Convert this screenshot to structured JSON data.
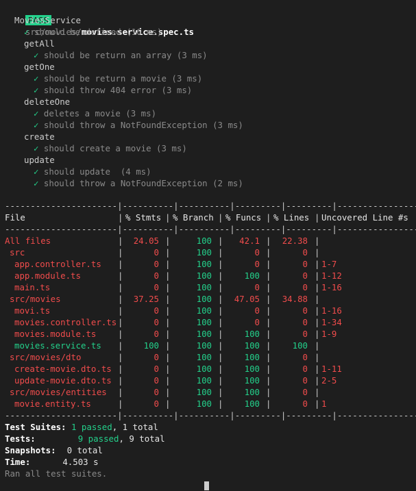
{
  "header": {
    "badge": "PASS",
    "path_dir": "src/movies/",
    "path_file": "movies.service.spec.ts"
  },
  "suite": {
    "name": "MoviesService",
    "groups": [
      {
        "name": "",
        "tests": [
          "should be defined (16 ms)"
        ]
      },
      {
        "name": "getAll",
        "tests": [
          "should be return an array (3 ms)"
        ]
      },
      {
        "name": "getOne",
        "tests": [
          "should be return a movie (3 ms)",
          "should throw 404 error (3 ms)"
        ]
      },
      {
        "name": "deleteOne",
        "tests": [
          "deletes a movie (3 ms)",
          "should throw a NotFoundException (3 ms)"
        ]
      },
      {
        "name": "create",
        "tests": [
          "should create a movie (3 ms)"
        ]
      },
      {
        "name": "update",
        "tests": [
          "should update  (4 ms)",
          "should throw a NotFoundException (2 ms)"
        ]
      }
    ],
    "check_glyph": "✓"
  },
  "coverage": {
    "divider": "----------------------|----------|----------|---------|---------|-------------------",
    "headers": [
      "File",
      "% Stmts",
      "% Branch",
      "% Funcs",
      "% Lines",
      "Uncovered Line #s"
    ],
    "rows": [
      {
        "file": "All files",
        "indent": 0,
        "stmts": "24.05",
        "branch": "100",
        "funcs": "42.1",
        "lines": "22.38",
        "uncovered": "",
        "file_color": "red",
        "colors": [
          "red",
          "green",
          "red",
          "red"
        ]
      },
      {
        "file": "src",
        "indent": 1,
        "stmts": "0",
        "branch": "100",
        "funcs": "0",
        "lines": "0",
        "uncovered": "",
        "file_color": "red",
        "colors": [
          "red",
          "green",
          "red",
          "red"
        ]
      },
      {
        "file": "app.controller.ts",
        "indent": 2,
        "stmts": "0",
        "branch": "100",
        "funcs": "0",
        "lines": "0",
        "uncovered": "1-7",
        "file_color": "red",
        "colors": [
          "red",
          "green",
          "red",
          "red"
        ]
      },
      {
        "file": "app.module.ts",
        "indent": 2,
        "stmts": "0",
        "branch": "100",
        "funcs": "100",
        "lines": "0",
        "uncovered": "1-12",
        "file_color": "red",
        "colors": [
          "red",
          "green",
          "green",
          "red"
        ]
      },
      {
        "file": "main.ts",
        "indent": 2,
        "stmts": "0",
        "branch": "100",
        "funcs": "0",
        "lines": "0",
        "uncovered": "1-16",
        "file_color": "red",
        "colors": [
          "red",
          "green",
          "red",
          "red"
        ]
      },
      {
        "file": "src/movies",
        "indent": 1,
        "stmts": "37.25",
        "branch": "100",
        "funcs": "47.05",
        "lines": "34.88",
        "uncovered": "",
        "file_color": "red",
        "colors": [
          "red",
          "green",
          "red",
          "red"
        ]
      },
      {
        "file": "movi.ts",
        "indent": 2,
        "stmts": "0",
        "branch": "100",
        "funcs": "0",
        "lines": "0",
        "uncovered": "1-16",
        "file_color": "red",
        "colors": [
          "red",
          "green",
          "red",
          "red"
        ]
      },
      {
        "file": "movies.controller.ts",
        "indent": 2,
        "stmts": "0",
        "branch": "100",
        "funcs": "0",
        "lines": "0",
        "uncovered": "1-34",
        "file_color": "red",
        "colors": [
          "red",
          "green",
          "red",
          "red"
        ]
      },
      {
        "file": "movies.module.ts",
        "indent": 2,
        "stmts": "0",
        "branch": "100",
        "funcs": "100",
        "lines": "0",
        "uncovered": "1-9",
        "file_color": "red",
        "colors": [
          "red",
          "green",
          "green",
          "red"
        ]
      },
      {
        "file": "movies.service.ts",
        "indent": 2,
        "stmts": "100",
        "branch": "100",
        "funcs": "100",
        "lines": "100",
        "uncovered": "",
        "file_color": "green",
        "colors": [
          "green",
          "green",
          "green",
          "green"
        ]
      },
      {
        "file": "src/movies/dto",
        "indent": 1,
        "stmts": "0",
        "branch": "100",
        "funcs": "100",
        "lines": "0",
        "uncovered": "",
        "file_color": "red",
        "colors": [
          "red",
          "green",
          "green",
          "red"
        ]
      },
      {
        "file": "create-movie.dto.ts",
        "indent": 2,
        "stmts": "0",
        "branch": "100",
        "funcs": "100",
        "lines": "0",
        "uncovered": "1-11",
        "file_color": "red",
        "colors": [
          "red",
          "green",
          "green",
          "red"
        ]
      },
      {
        "file": "update-movie.dto.ts",
        "indent": 2,
        "stmts": "0",
        "branch": "100",
        "funcs": "100",
        "lines": "0",
        "uncovered": "2-5",
        "file_color": "red",
        "colors": [
          "red",
          "green",
          "green",
          "red"
        ]
      },
      {
        "file": "src/movies/entities",
        "indent": 1,
        "stmts": "0",
        "branch": "100",
        "funcs": "100",
        "lines": "0",
        "uncovered": "",
        "file_color": "red",
        "colors": [
          "red",
          "green",
          "green",
          "red"
        ]
      },
      {
        "file": "movie.entity.ts",
        "indent": 2,
        "stmts": "0",
        "branch": "100",
        "funcs": "100",
        "lines": "0",
        "uncovered": "1",
        "file_color": "red",
        "colors": [
          "red",
          "green",
          "green",
          "red"
        ]
      }
    ]
  },
  "summary": {
    "suites_label": "Test Suites:",
    "suites_passed": "1 passed",
    "suites_total": ", 1 total",
    "tests_label": "Tests:",
    "tests_passed": "9 passed",
    "tests_total": ", 9 total",
    "snapshots_label": "Snapshots:",
    "snapshots_value": "0 total",
    "time_label": "Time:",
    "time_value": "4.503 s",
    "ran_all": "Ran all test suites."
  }
}
